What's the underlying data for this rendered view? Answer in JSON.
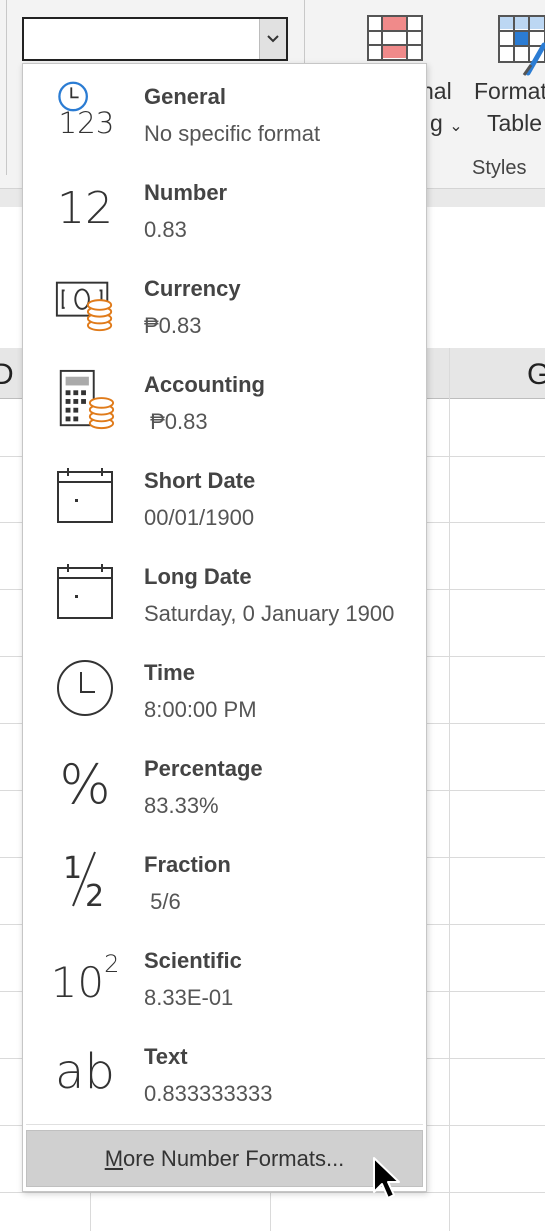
{
  "ribbon": {
    "conditional_line1": "nal",
    "conditional_line2": "g",
    "format_table_line1": "Format",
    "format_table_line2": "Table",
    "group_label": "Styles"
  },
  "sheet": {
    "col_left": "D",
    "col_right": "G"
  },
  "combo": {
    "value": "",
    "dropdown_icon": "chevron-down-icon"
  },
  "menu": {
    "items": [
      {
        "name": "General",
        "sample": "No specific format",
        "icon": "general-clock-123-icon"
      },
      {
        "name": "Number",
        "sample": "0.83",
        "icon": "number-12-icon"
      },
      {
        "name": "Currency",
        "sample": "₱0.83",
        "icon": "currency-banknote-coins-icon"
      },
      {
        "name": "Accounting",
        "sample": " ₱0.83",
        "icon": "accounting-calculator-coins-icon"
      },
      {
        "name": "Short Date",
        "sample": "00/01/1900",
        "icon": "short-date-calendar-icon"
      },
      {
        "name": "Long Date",
        "sample": "Saturday, 0 January 1900",
        "icon": "long-date-calendar-icon"
      },
      {
        "name": "Time",
        "sample": "8:00:00 PM",
        "icon": "clock-icon"
      },
      {
        "name": "Percentage",
        "sample": "83.33%",
        "icon": "percent-icon"
      },
      {
        "name": "Fraction",
        "sample": " 5/6",
        "icon": "fraction-half-icon"
      },
      {
        "name": "Scientific",
        "sample": "8.33E-01",
        "icon": "scientific-ten-squared-icon"
      },
      {
        "name": "Text",
        "sample": "0.833333333",
        "icon": "text-ab-icon"
      }
    ],
    "more_accel": "M",
    "more_rest": "ore Number Formats..."
  },
  "glyphs": {
    "n123": "123",
    "n12": "12",
    "percent": "%",
    "ten": "10",
    "two": "2",
    "ab": "ab"
  },
  "colors": {
    "accent_blue": "#2b7cd3",
    "coin_orange": "#e07b1a",
    "highlight_gray": "#d0d0d0"
  }
}
